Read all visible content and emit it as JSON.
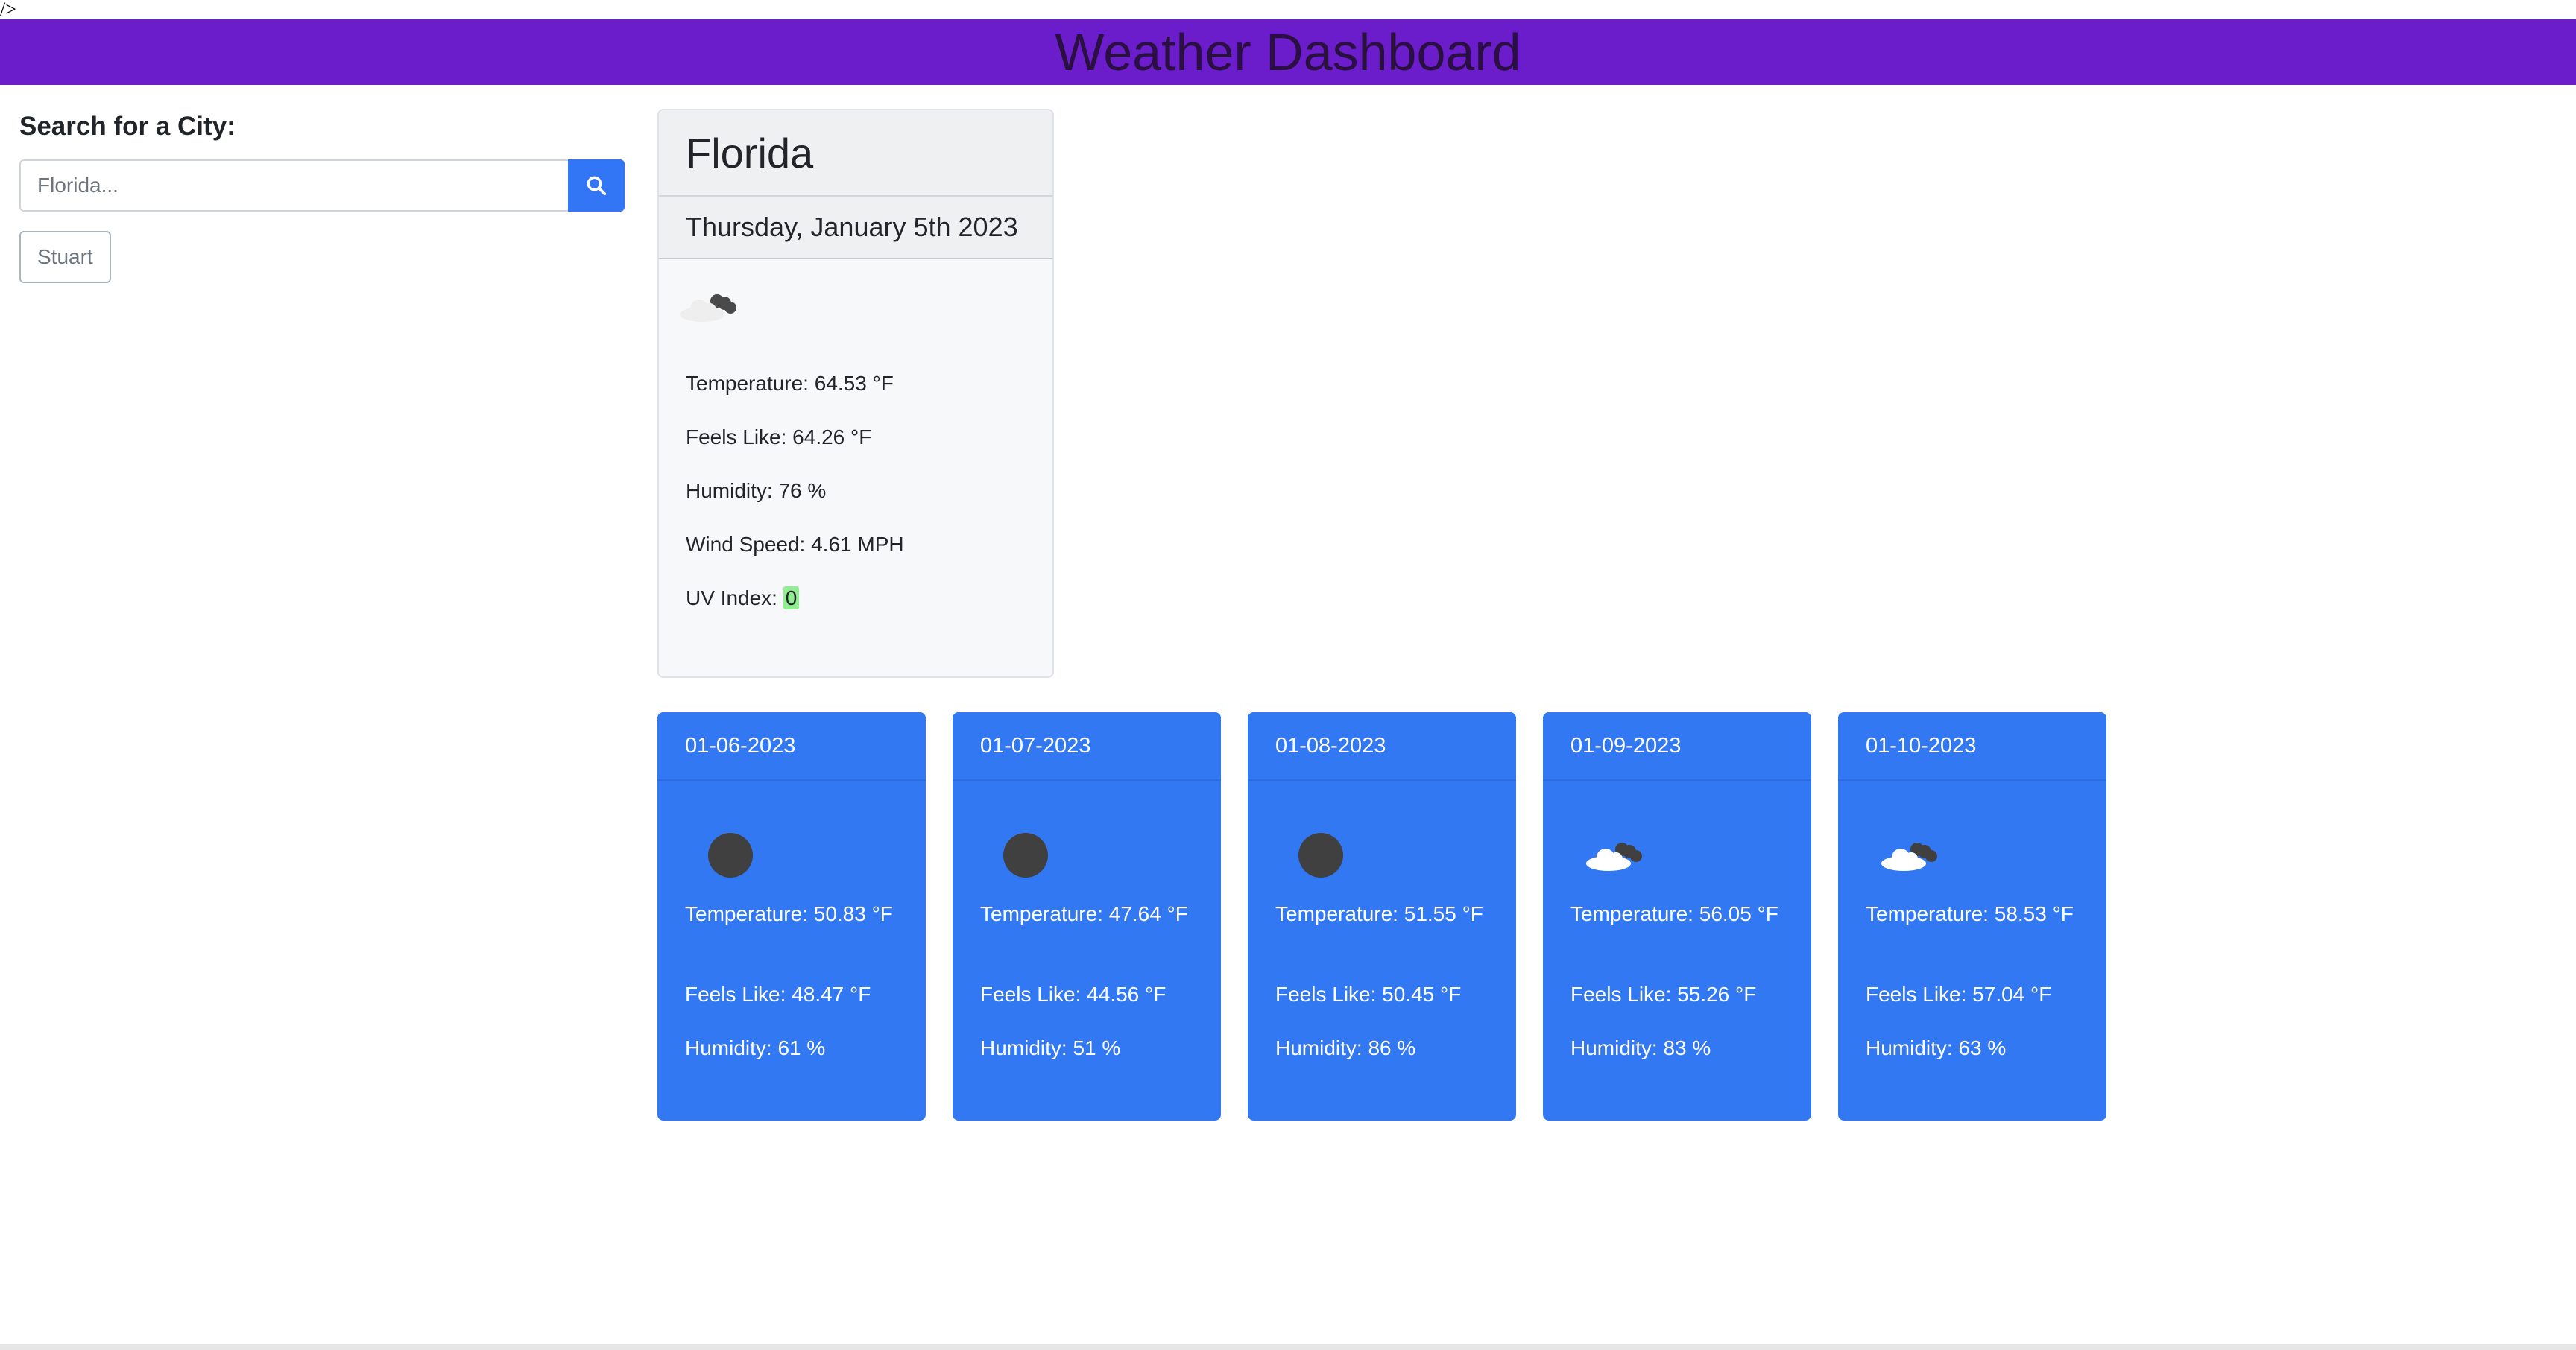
{
  "stray_text": "/>",
  "header": {
    "title": "Weather Dashboard"
  },
  "sidebar": {
    "search_label": "Search for a City:",
    "search_placeholder": "Florida...",
    "search_button_icon": "search-icon",
    "history": [
      "Stuart"
    ]
  },
  "current": {
    "city": "Florida",
    "date": "Thursday, January 5th 2023",
    "icon": "broken-clouds-icon",
    "temperature": "Temperature: 64.53 °F",
    "feels_like": "Feels Like: 64.26 °F",
    "humidity": "Humidity: 76 %",
    "wind_speed": "Wind Speed: 4.61 MPH",
    "uv_label": "UV Index: ",
    "uv_value": "0"
  },
  "forecast": [
    {
      "date": "01-06-2023",
      "icon": "clear-night-icon",
      "temperature": "Temperature: 50.83 °F",
      "feels_like": "Feels Like: 48.47 °F",
      "humidity": "Humidity: 61 %"
    },
    {
      "date": "01-07-2023",
      "icon": "clear-night-icon",
      "temperature": "Temperature: 47.64 °F",
      "feels_like": "Feels Like: 44.56 °F",
      "humidity": "Humidity: 51 %"
    },
    {
      "date": "01-08-2023",
      "icon": "clear-night-icon",
      "temperature": "Temperature: 51.55 °F",
      "feels_like": "Feels Like: 50.45 °F",
      "humidity": "Humidity: 86 %"
    },
    {
      "date": "01-09-2023",
      "icon": "broken-clouds-icon",
      "temperature": "Temperature: 56.05 °F",
      "feels_like": "Feels Like: 55.26 °F",
      "humidity": "Humidity: 83 %"
    },
    {
      "date": "01-10-2023",
      "icon": "broken-clouds-icon",
      "temperature": "Temperature: 58.53 °F",
      "feels_like": "Feels Like: 57.04 °F",
      "humidity": "Humidity: 63 %"
    }
  ],
  "colors": {
    "header_bg": "#6b1ccb",
    "accent": "#3276f5",
    "forecast_bg": "#3378f3",
    "uv_low": "#90ee90"
  }
}
